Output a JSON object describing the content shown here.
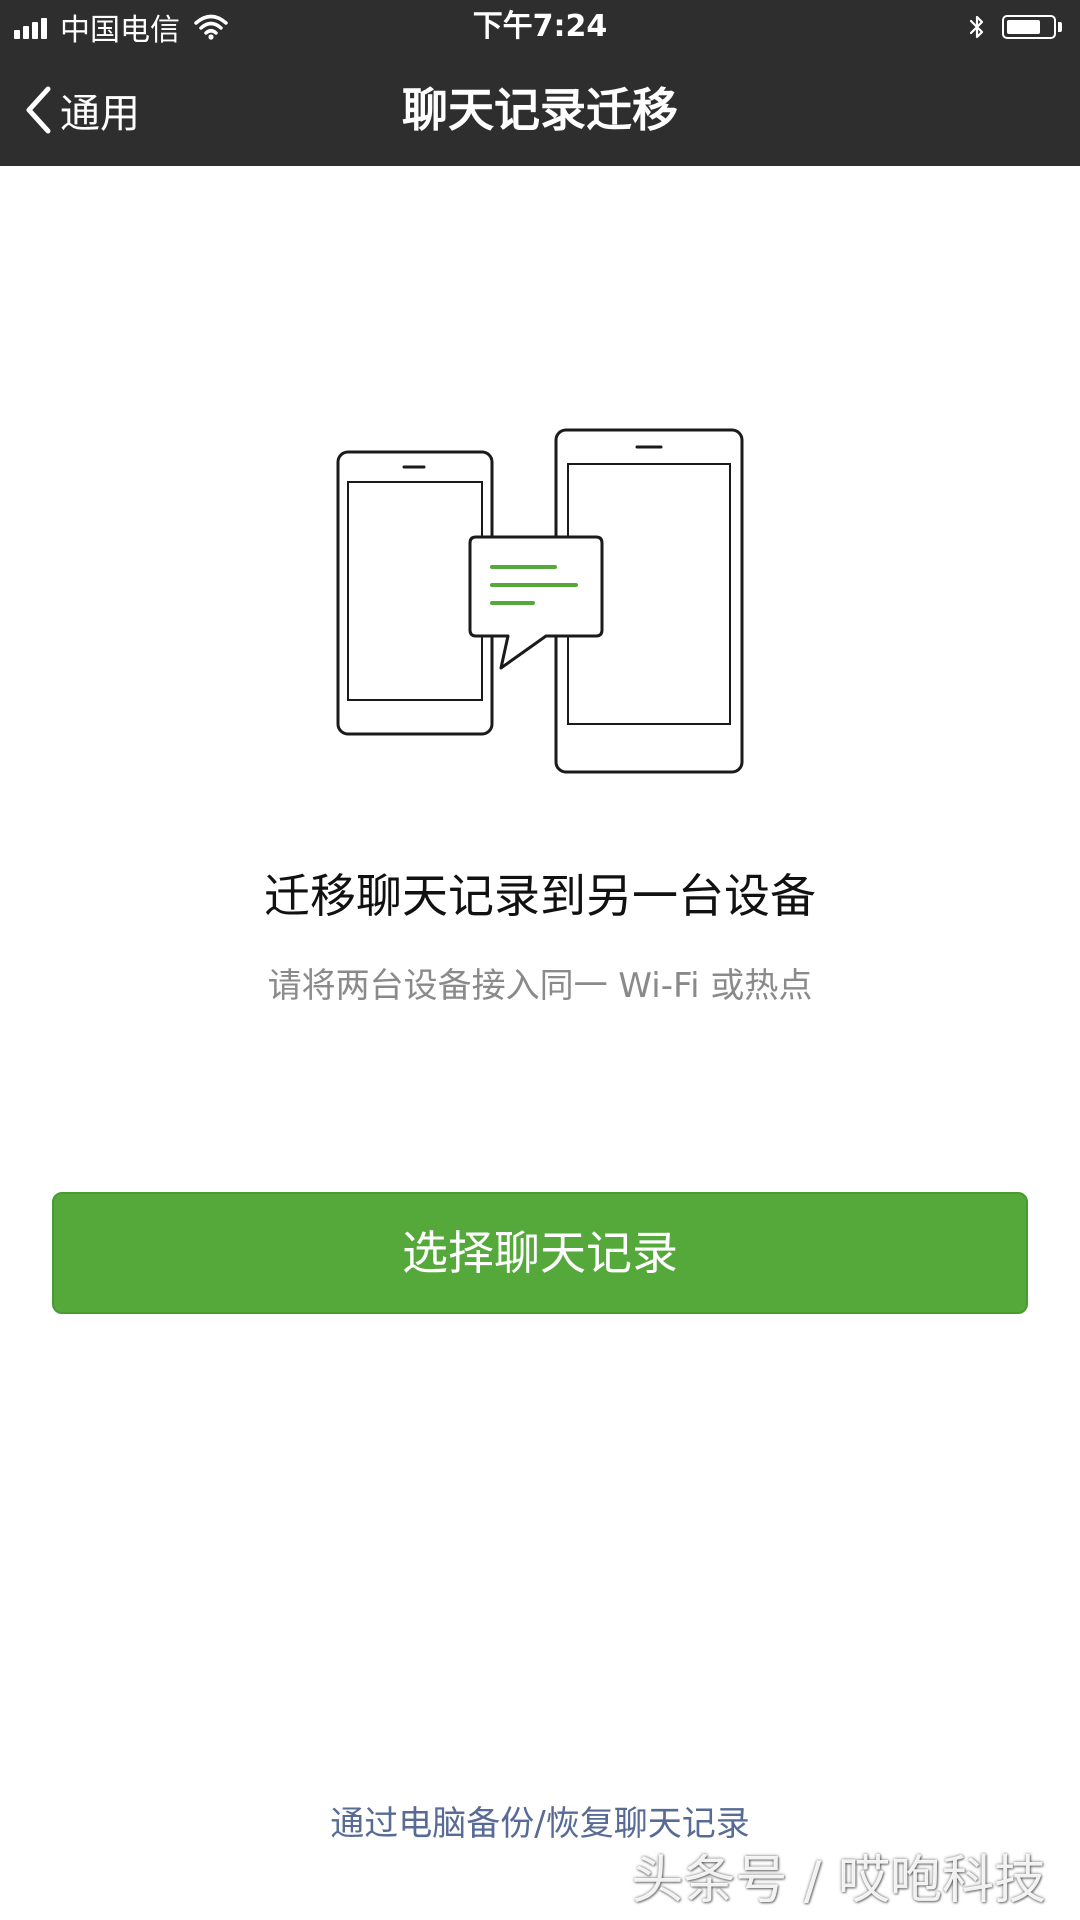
{
  "status_bar": {
    "carrier": "中国电信",
    "time": "下午7:24",
    "signal_icon": "signal-bars-icon",
    "wifi_icon": "wifi-icon",
    "bluetooth_icon": "bluetooth-icon",
    "battery_icon": "battery-icon",
    "battery_level_percent": 75
  },
  "nav": {
    "back_label": "通用",
    "back_icon": "chevron-left-icon",
    "title": "聊天记录迁移"
  },
  "main": {
    "illustration_icon": "phones-transfer-icon",
    "headline": "迁移聊天记录到另一台设备",
    "subtext": "请将两台设备接入同一 Wi-Fi 或热点",
    "primary_button_label": "选择聊天记录",
    "bottom_link": "通过电脑备份/恢复聊天记录"
  },
  "watermark": {
    "text": "头条号 / 哎咆科技"
  },
  "colors": {
    "bar_bg": "#2e2e2e",
    "accent_green": "#55a93b",
    "link_blue": "#576b95",
    "subtext_gray": "#8a8a8a"
  }
}
